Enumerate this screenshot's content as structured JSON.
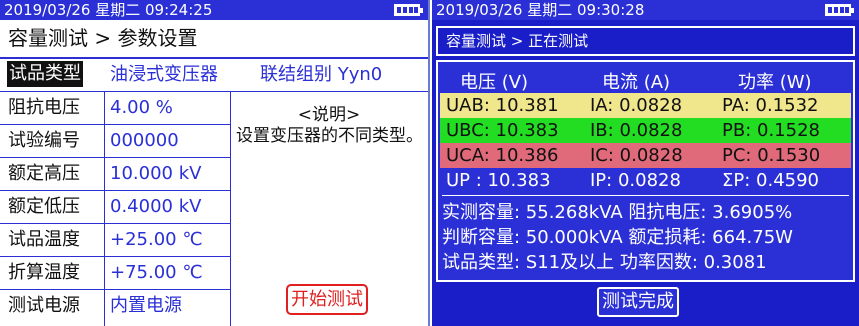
{
  "left": {
    "status": {
      "datetime": "2019/03/26 星期二 09:24:25",
      "battery_icon": "battery-icon"
    },
    "title": "容量测试 > 参数设置",
    "sample_type": {
      "label": "试品类型",
      "value": "油浸式变压器",
      "group": "联结组别 Yyn0"
    },
    "params": [
      {
        "label": "阻抗电压",
        "value": "4.00 %"
      },
      {
        "label": "试验编号",
        "value": "000000"
      },
      {
        "label": "额定高压",
        "value": "10.000 kV"
      },
      {
        "label": "额定低压",
        "value": "0.4000 kV"
      },
      {
        "label": "试品温度",
        "value": "+25.00 ℃"
      },
      {
        "label": "折算温度",
        "value": "+75.00 ℃"
      },
      {
        "label": "测试电源",
        "value": "内置电源"
      }
    ],
    "note": {
      "title": "<说明>",
      "text": "设置变压器的不同类型。"
    },
    "start_button": "开始测试"
  },
  "right": {
    "status": {
      "datetime": "2019/03/26 星期二 09:30:28",
      "battery_icon": "battery-icon"
    },
    "title": "容量测试 > 正在测试",
    "headers": [
      "电压 (V)",
      "电流 (A)",
      "功率 (W)"
    ],
    "rows": [
      {
        "v": "UAB: 10.381",
        "i": "IA: 0.0828",
        "p": "PA: 0.1532",
        "bg": "#f0e68c",
        "fg": "#111111"
      },
      {
        "v": "UBC: 10.383",
        "i": "IB: 0.0828",
        "p": "PB: 0.1528",
        "bg": "#22dd22",
        "fg": "#111111"
      },
      {
        "v": "UCA: 10.386",
        "i": "IC: 0.0828",
        "p": "PC: 0.1530",
        "bg": "#e06a7a",
        "fg": "#111111"
      },
      {
        "v": "UP : 10.383",
        "i": "IP: 0.0828",
        "p": "ΣP: 0.4590",
        "bg": "#2a2fd6",
        "fg": "#ffffff"
      }
    ],
    "summary": [
      "实测容量: 55.268kVA 阻抗电压: 3.6905%",
      "判断容量: 50.000kVA 额定损耗: 664.75W",
      "试品类型: S11及以上 功率因数: 0.3081"
    ],
    "done_button": "测试完成"
  }
}
